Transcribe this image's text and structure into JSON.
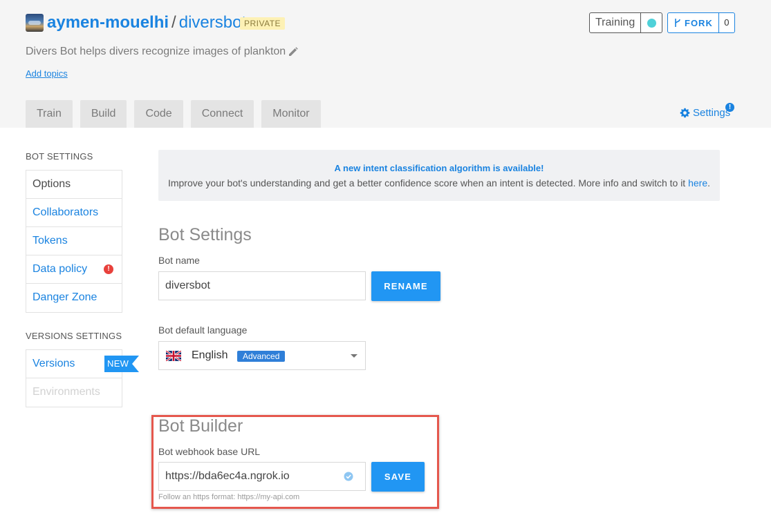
{
  "header": {
    "owner": "aymen-mouelhi",
    "separator": "/",
    "repo": "diversbot",
    "visibility_badge": "PRIVATE",
    "description": "Divers Bot helps divers recognize images of plankton",
    "add_topics": "Add topics",
    "training_label": "Training",
    "training_status_color": "#4fd1d9",
    "fork_label": "FORK",
    "fork_count": "0",
    "tabs": [
      "Train",
      "Build",
      "Code",
      "Connect",
      "Monitor"
    ],
    "settings_label": "Settings",
    "settings_badge": "!"
  },
  "sidebar": {
    "bot_settings_label": "BOT SETTINGS",
    "bot_items": [
      "Options",
      "Collaborators",
      "Tokens",
      "Data policy",
      "Danger Zone"
    ],
    "data_policy_alert": "!",
    "versions_settings_label": "VERSIONS SETTINGS",
    "version_items": [
      "Versions",
      "Environments"
    ],
    "new_ribbon": "NEW"
  },
  "notice": {
    "title": "A new intent classification algorithm is available!",
    "text": "Improve your bot's understanding and get a better confidence score when an intent is detected. More info and switch to it ",
    "link": "here",
    "suffix": "."
  },
  "bot_settings": {
    "title": "Bot Settings",
    "name_label": "Bot name",
    "name_value": "diversbot",
    "rename_button": "RENAME",
    "language_label": "Bot default language",
    "language_value": "English",
    "language_badge": "Advanced"
  },
  "bot_builder": {
    "title": "Bot Builder",
    "webhook_label": "Bot webhook base URL",
    "webhook_value": "https://bda6ec4a.ngrok.io",
    "save_button": "SAVE",
    "helper": "Follow an https format: https://my-api.com"
  },
  "colors": {
    "accent": "#1a83e0",
    "button": "#2196f3",
    "highlight_frame": "#e5574d",
    "alert": "#e8413c",
    "private_badge_bg": "#fdf1b5"
  }
}
